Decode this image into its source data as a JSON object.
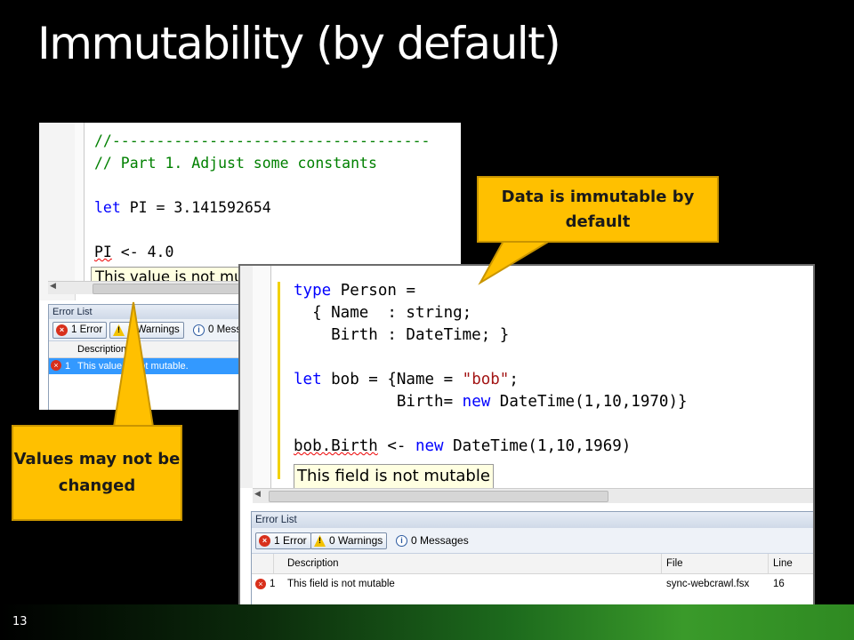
{
  "slide": {
    "title": "Immutability (by default)",
    "number": "13"
  },
  "editor1": {
    "code_lines": [
      "//------------------------------------",
      "// Part 1. Adjust some constants",
      "",
      "let PI = 3.141592654",
      "",
      "PI <- 4.0"
    ],
    "tooltip": "This value is not mutable.",
    "error_list": {
      "title": "Error List",
      "errors_button": "1 Error",
      "warnings_button": "0 Warnings",
      "messages_button": "0 Messages",
      "col_description": "Description",
      "row_index": "1",
      "row_description": "This value is not mutable."
    }
  },
  "editor2": {
    "tooltip": "This field is not mutable",
    "error_list": {
      "title": "Error List",
      "errors_button": "1 Error",
      "warnings_button": "0 Warnings",
      "messages_button": "0 Messages",
      "col_description": "Description",
      "col_file": "File",
      "col_line": "Line",
      "row_index": "1",
      "row_description": "This field is not mutable",
      "row_file": "sync-webcrawl.fsx",
      "row_line": "16"
    }
  },
  "callouts": {
    "immutable": "Data is immutable by default",
    "values": "Values may not be changed"
  },
  "colors": {
    "keyword": "#0000ff",
    "comment": "#008000",
    "string": "#a31515",
    "callout": "#ffc000",
    "tooltip_bg": "#ffffe1"
  }
}
